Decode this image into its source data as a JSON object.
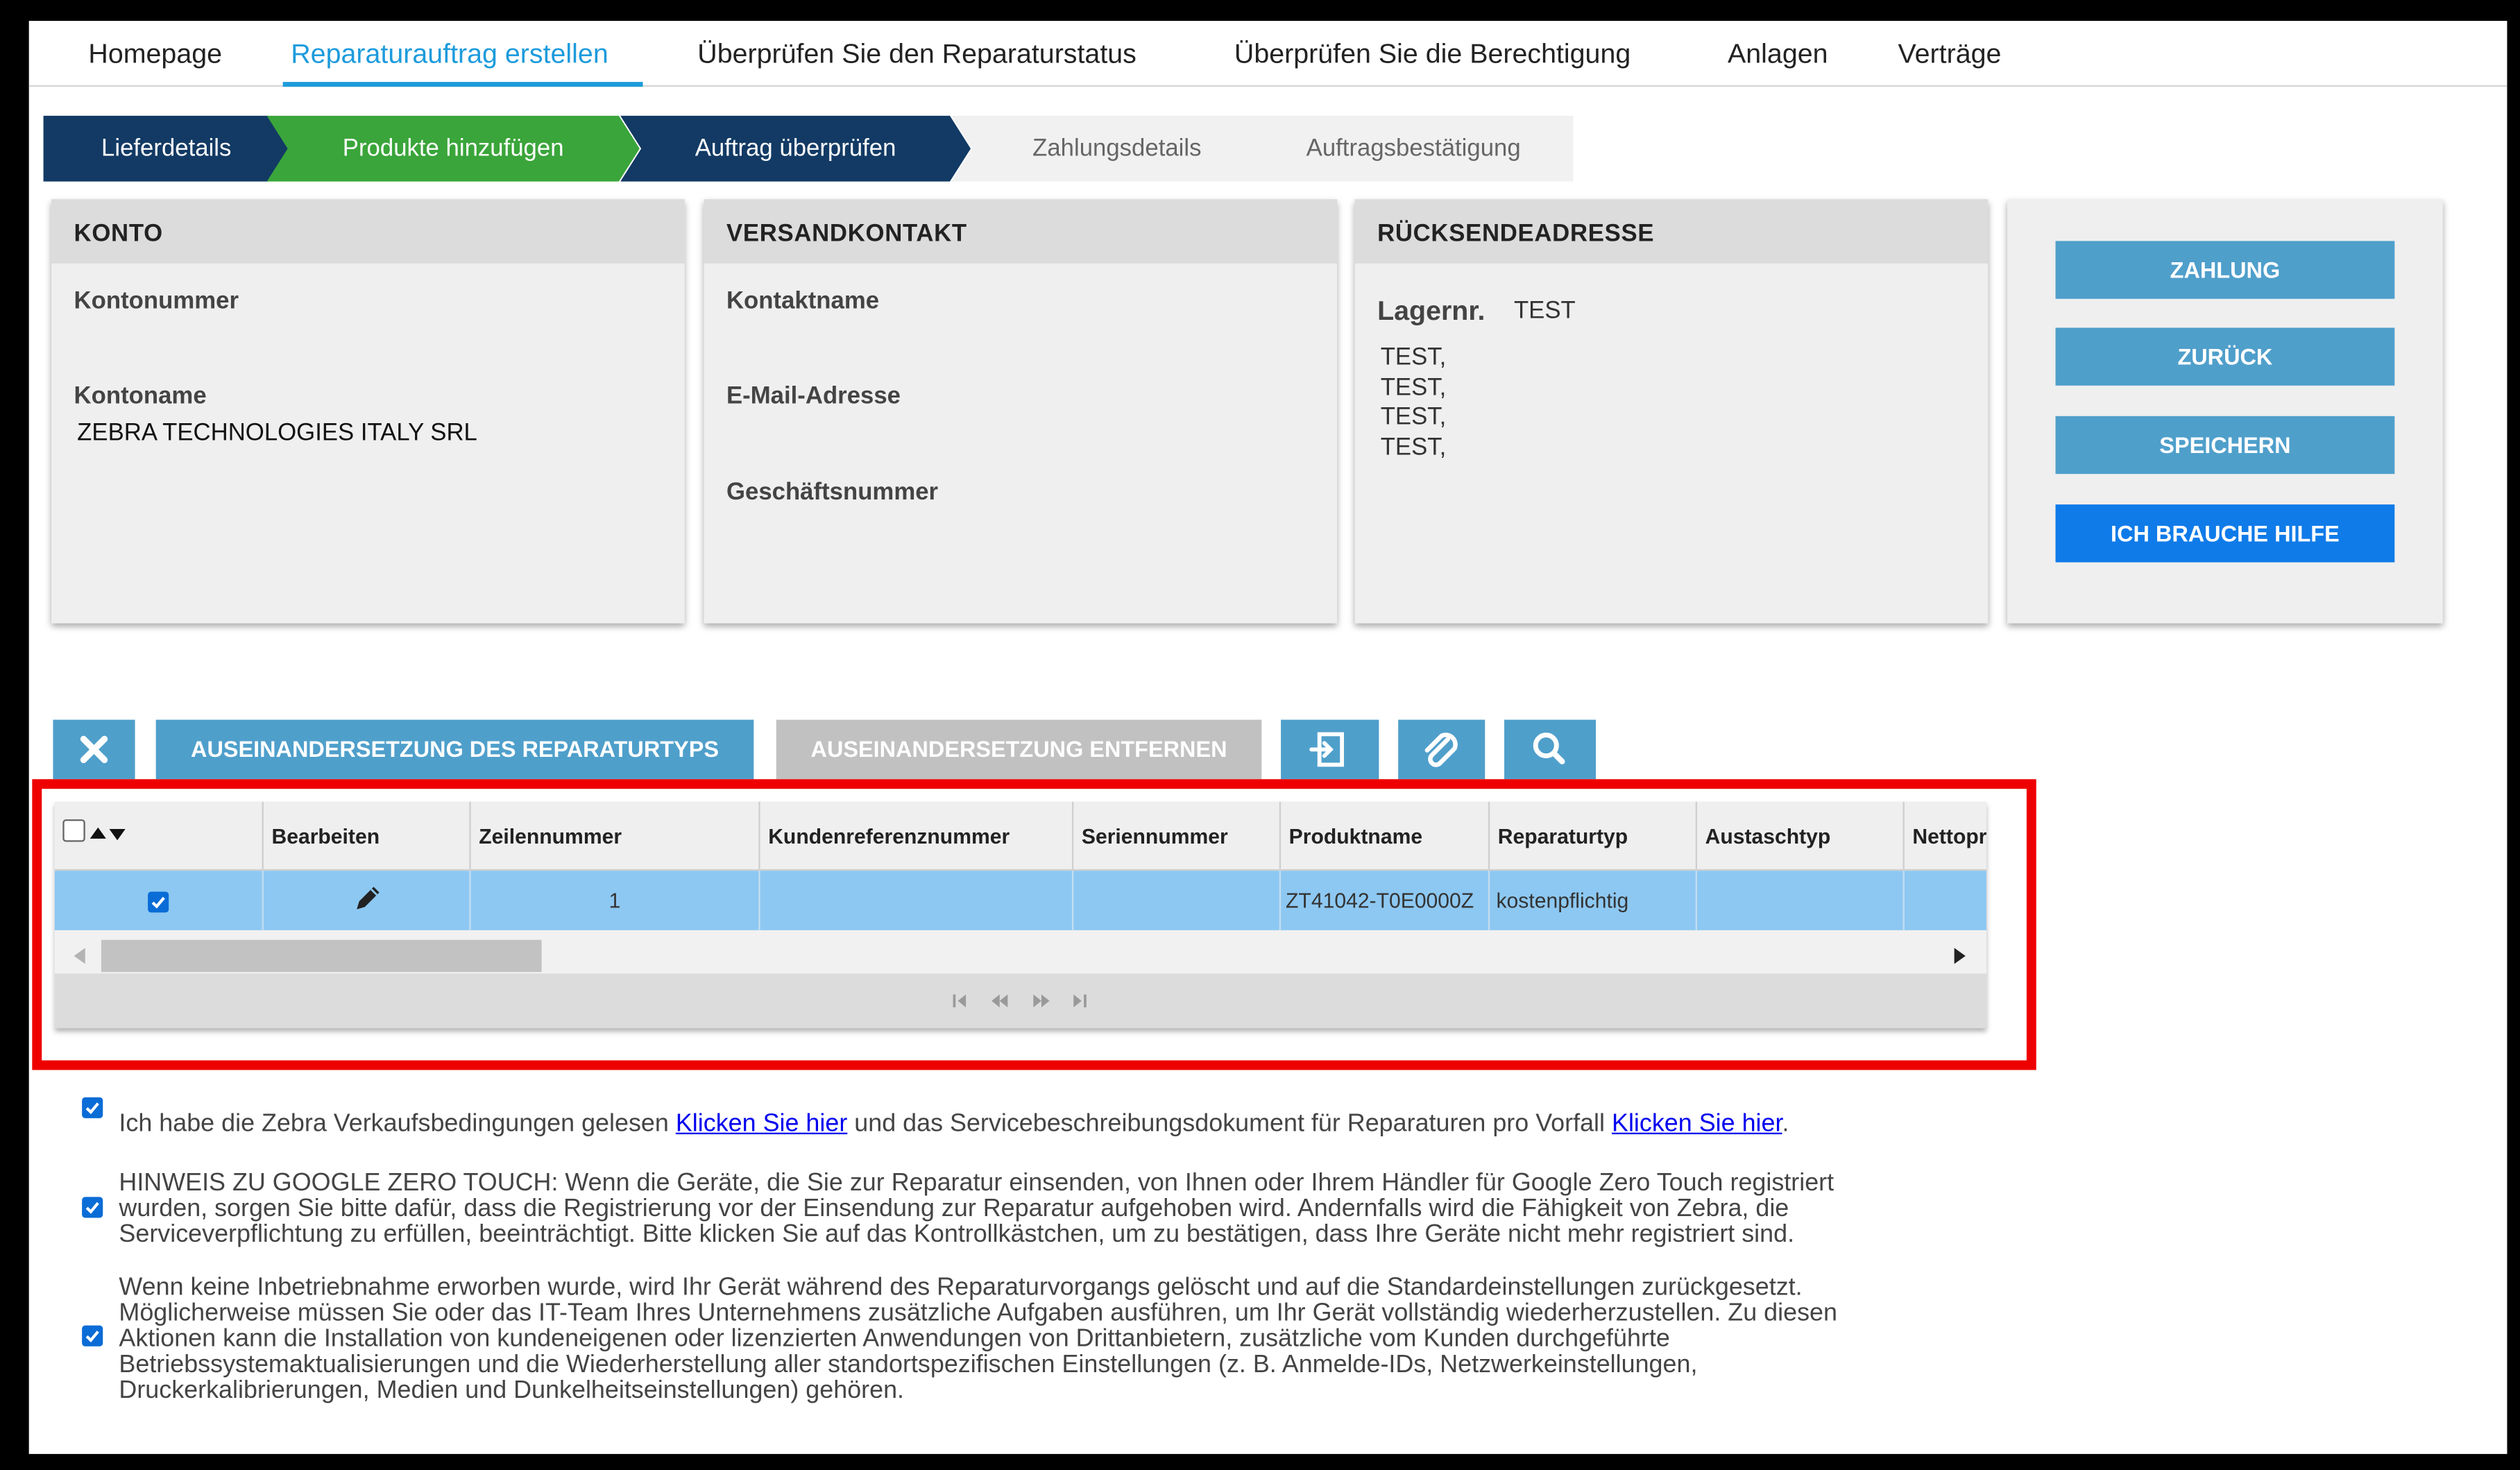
{
  "nav": {
    "items": [
      "Homepage",
      "Reparaturauftrag erstellen",
      "Überprüfen Sie den Reparaturstatus",
      "Überprüfen Sie die Berechtigung",
      "Anlagen",
      "Verträge"
    ],
    "active_index": 1
  },
  "steps": [
    "Lieferdetails",
    "Produkte hinzufügen",
    "Auftrag überprüfen",
    "Zahlungsdetails",
    "Auftragsbestätigung"
  ],
  "konto": {
    "title": "KONTO",
    "kontonummer_label": "Kontonummer",
    "kontoname_label": "Kontoname",
    "kontoname_value": "ZEBRA TECHNOLOGIES ITALY SRL"
  },
  "versand": {
    "title": "VERSANDKONTAKT",
    "kontaktname_label": "Kontaktname",
    "email_label": "E-Mail-Adresse",
    "geschaeft_label": "Geschäftsnummer"
  },
  "ruecksende": {
    "title": "RÜCKSENDEADRESSE",
    "lager_label": "Lagernr.",
    "lager_value": "TEST",
    "lines": [
      "TEST,",
      "TEST,",
      "TEST,",
      "TEST,"
    ]
  },
  "actions": {
    "zahlung": "ZAHLUNG",
    "zurueck": "ZURÜCK",
    "speichern": "SPEICHERN",
    "hilfe": "ICH BRAUCHE HILFE"
  },
  "toolbar": {
    "close_icon": "close-icon",
    "apply_label": "AUSEINANDERSETZUNG DES REPARATURTYPS",
    "remove_label": "AUSEINANDERSETZUNG ENTFERNEN",
    "export_icon": "export-icon",
    "attach_icon": "paperclip-icon",
    "search_icon": "search-icon"
  },
  "grid": {
    "headers": [
      "",
      "Bearbeiten",
      "Zeilennummer",
      "Kundenreferenznummer",
      "Seriennummer",
      "Produktname",
      "Reparaturtyp",
      "Austaschtyp",
      "Nettopr"
    ],
    "rows": [
      {
        "selected": true,
        "zeilennummer": "1",
        "kundenreferenz": "",
        "serie": "",
        "produktname": "ZT41042-T0E0000Z",
        "reparaturtyp": "kostenpflichtig",
        "austausch": ""
      }
    ]
  },
  "notices": {
    "n1_text1": "Ich habe die Zebra Verkaufsbedingungen gelesen ",
    "n1_link1": "Klicken Sie hier",
    "n1_text2": " und das Servicebeschreibungsdokument für Reparaturen pro Vorfall ",
    "n1_link2": "Klicken Sie hier",
    "n1_text3": ".",
    "n2_lines": [
      "HINWEIS ZU GOOGLE ZERO TOUCH: Wenn die Geräte, die Sie zur Reparatur einsenden, von Ihnen oder Ihrem Händler für Google Zero Touch registriert",
      "wurden, sorgen Sie bitte dafür, dass die Registrierung vor der Einsendung zur Reparatur aufgehoben wird. Andernfalls wird die Fähigkeit von Zebra, die",
      "Serviceverpflichtung zu erfüllen, beeinträchtigt. Bitte klicken Sie auf das Kontrollkästchen, um zu bestätigen, dass Ihre Geräte nicht mehr registriert sind."
    ],
    "n3_lines": [
      "Wenn keine Inbetriebnahme erworben wurde, wird Ihr Gerät während des Reparaturvorgangs gelöscht und auf die Standardeinstellungen zurückgesetzt.",
      "Möglicherweise müssen Sie oder das IT-Team Ihres Unternehmens zusätzliche Aufgaben ausführen, um Ihr Gerät vollständig wiederherzustellen. Zu diesen",
      "Aktionen kann die Installation von kundeneigenen oder lizenzierten Anwendungen von Drittanbietern, zusätzliche vom Kunden durchgeführte",
      "Betriebssystemaktualisierungen und die Wiederherstellung aller standortspezifischen Einstellungen (z. B. Anmelde-IDs, Netzwerkeinstellungen,",
      "Druckerkalibrierungen, Medien und Dunkelheitseinstellungen) gehören."
    ]
  }
}
